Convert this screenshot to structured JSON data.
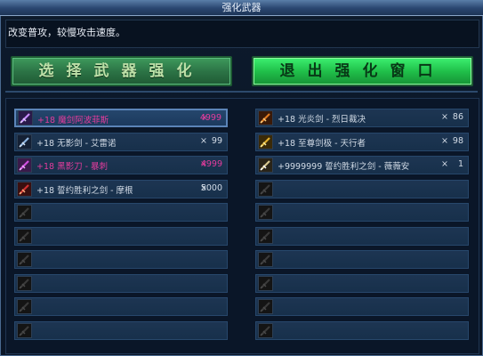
{
  "window": {
    "title": "强化武器"
  },
  "description": "改变普攻，较慢攻击速度。",
  "buttons": {
    "select": "选择武器强化",
    "exit": "退出强化窗口"
  },
  "times_symbol": "×",
  "left_items": [
    {
      "name": "+18 魔剑阿波菲斯",
      "count": "4999",
      "color": "pink",
      "icon": "purple-spark-sword-icon",
      "selected": true
    },
    {
      "name": "+18 无影剑 - 艾雷诺",
      "count": "99",
      "color": "white",
      "icon": "blue-sword-icon",
      "selected": false
    },
    {
      "name": "+18 黑影刀 - 暴刺",
      "count": "4999",
      "color": "pink",
      "icon": "purple-blade-icon",
      "selected": false
    },
    {
      "name": "+18 誓约胜利之剑 - 摩根",
      "count": "5000",
      "color": "white",
      "icon": "red-sword-icon",
      "selected": false
    }
  ],
  "right_items": [
    {
      "name": "+18 光炎剑 - 烈日裁决",
      "count": "86",
      "color": "white",
      "icon": "flame-sword-icon"
    },
    {
      "name": "+18 至尊剑极 - 天行者",
      "count": "98",
      "color": "white",
      "icon": "gold-sword-icon"
    },
    {
      "name": "+9999999 誓约胜利之剑 - 薇薇安",
      "count": "1",
      "color": "white",
      "icon": "holy-sword-icon"
    }
  ],
  "empty_slot_icon": "empty-sword-slot-icon",
  "colors": {
    "pink_text": "#e23c9c",
    "white_text": "#d2dbe6",
    "exit_button": "#20c04a",
    "select_button": "#2c7446"
  }
}
